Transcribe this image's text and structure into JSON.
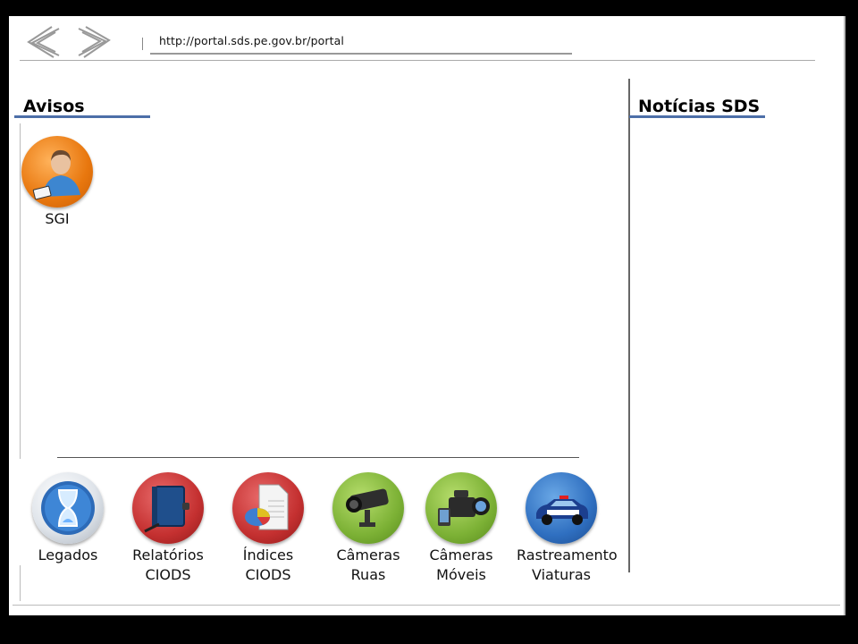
{
  "browser": {
    "url": "http://portal.sds.pe.gov.br/portal",
    "back_icon": "chevron-left-icon",
    "forward_icon": "chevron-right-icon"
  },
  "avisos": {
    "title": "Avisos",
    "apps": [
      {
        "label": "SGI",
        "icon": "user-badge-icon"
      }
    ]
  },
  "noticias": {
    "title": "Notícias SDS"
  },
  "bottom_apps": [
    {
      "line1": "Legados",
      "line2": "",
      "icon": "hourglass-icon",
      "color": "#e0e5ea"
    },
    {
      "line1": "Relatórios",
      "line2": "CIODS",
      "icon": "notebook-icon",
      "color": "#c43030"
    },
    {
      "line1": "Índices",
      "line2": "CIODS",
      "icon": "pie-chart-document-icon",
      "color": "#c43030"
    },
    {
      "line1": "Câmeras",
      "line2": "Ruas",
      "icon": "security-camera-icon",
      "color": "#7cb135"
    },
    {
      "line1": "Câmeras",
      "line2": "Móveis",
      "icon": "video-camera-icon",
      "color": "#7cb135"
    },
    {
      "line1": "Rastreamento",
      "line2": "Viaturas",
      "icon": "police-car-icon",
      "color": "#2f6fc0"
    }
  ],
  "colors": {
    "accent_underline": "#4d6fa8"
  }
}
